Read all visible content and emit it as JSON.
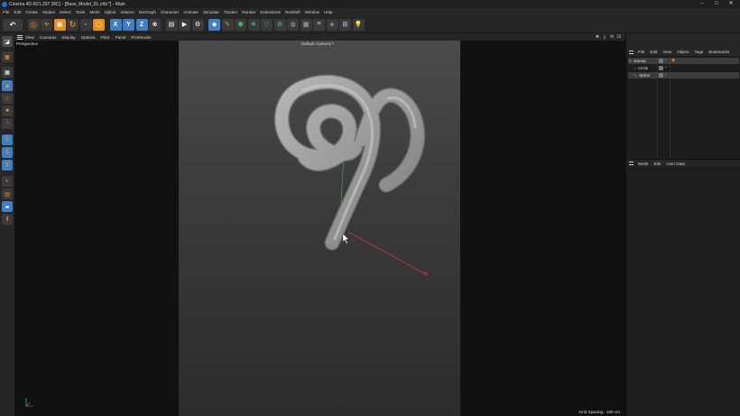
{
  "window": {
    "title": "Cinema 4D R21.207 (RC) - [Base_Model_01.c4d *] - Main",
    "minimize": "–",
    "maximize": "□",
    "close": "✕"
  },
  "menu": [
    "File",
    "Edit",
    "Create",
    "Modes",
    "Select",
    "Tools",
    "Mesh",
    "Spline",
    "Volume",
    "MoGraph",
    "Character",
    "Animate",
    "Simulate",
    "Tracker",
    "Render",
    "Extensions",
    "Redshift",
    "Window",
    "Help"
  ],
  "viewport": {
    "menu": [
      "View",
      "Cameras",
      "Display",
      "Options",
      "Filter",
      "Panel",
      "ProRender"
    ],
    "nav": [
      "✥",
      "⤓",
      "⟲",
      "⊡"
    ],
    "name": "Perspective",
    "camera": "Default Camera:*",
    "grid_spacing": "Grid Spacing : 100 cm"
  },
  "object_manager": {
    "menu": [
      "File",
      "Edit",
      "View",
      "Object",
      "Tags",
      "Bookmarks"
    ],
    "objects": [
      {
        "name": "Sweep",
        "selected": true
      },
      {
        "name": "Circle",
        "selected": false
      },
      {
        "name": "Spline",
        "selected": true
      }
    ]
  },
  "attribute_manager": {
    "menu": [
      "Mode",
      "Edit",
      "User Data"
    ]
  },
  "toolbar": {
    "xyz": [
      "X",
      "Y",
      "Z"
    ]
  },
  "colors": {
    "accent_orange": "#e8901a",
    "accent_blue": "#3e7fc8",
    "model_gray": "#9a9a9a",
    "axis_red": "#c0393f",
    "axis_green": "#3fae6a"
  }
}
